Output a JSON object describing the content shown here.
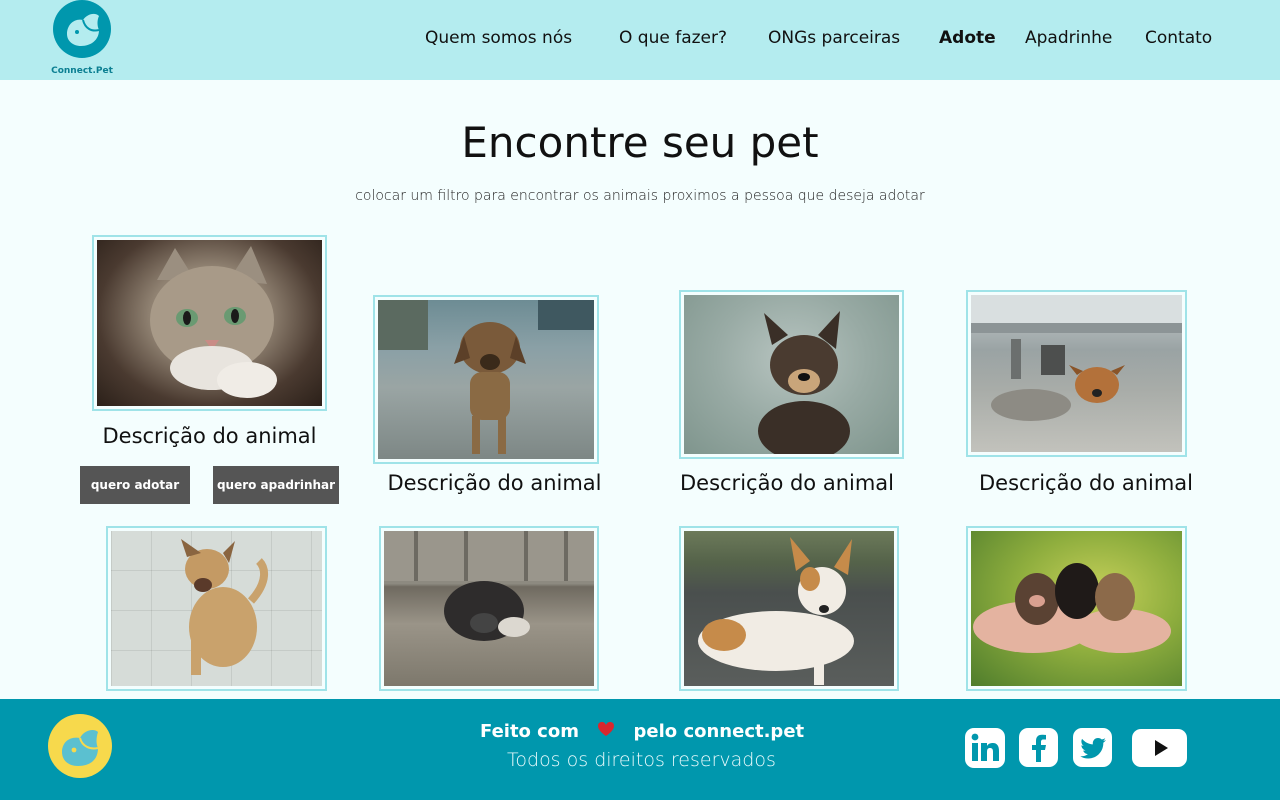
{
  "brand": {
    "logo_text": "Connect.Pet"
  },
  "nav": {
    "items": [
      {
        "label": "Quem somos nós"
      },
      {
        "label": "O que fazer?"
      },
      {
        "label": "ONGs parceiras"
      },
      {
        "label": "Adote"
      },
      {
        "label": "Apadrinhe"
      },
      {
        "label": "Contato"
      }
    ],
    "active": "Adote"
  },
  "main": {
    "title": "Encontre seu pet",
    "subtitle": "colocar um filtro para encontrar os animais proximos a pessoa que deseja adotar"
  },
  "cards": [
    {
      "description": "Descrição do animal",
      "photo": "cat-photo"
    },
    {
      "description": "Descrição do animal",
      "photo": "puppy-on-street-photo"
    },
    {
      "description": "Descrição do animal",
      "photo": "dog-in-field-photo"
    },
    {
      "description": "Descrição do animal",
      "photo": "puppy-under-car-photo"
    },
    {
      "photo": "dog-on-tiles-photo"
    },
    {
      "photo": "dog-under-fence-photo"
    },
    {
      "photo": "dog-white-brown-photo"
    },
    {
      "photo": "puppies-in-hands-photo"
    }
  ],
  "buttons": {
    "adopt_label": "quero adotar",
    "sponsor_label": "quero apadrinhar"
  },
  "footer": {
    "made_with_prefix": "Feito com",
    "made_with_suffix": "pelo connect.pet",
    "rights": "Todos os direitos reservados",
    "social": [
      "linkedin-icon",
      "facebook-icon",
      "twitter-icon",
      "youtube-icon"
    ]
  },
  "colors": {
    "header_bg": "#b4ecef",
    "footer_bg": "#0097ad",
    "page_bg": "#f4fefe",
    "button_bg": "#555555",
    "heart": "#d9272e",
    "footer_logo": "#f7d94c"
  }
}
